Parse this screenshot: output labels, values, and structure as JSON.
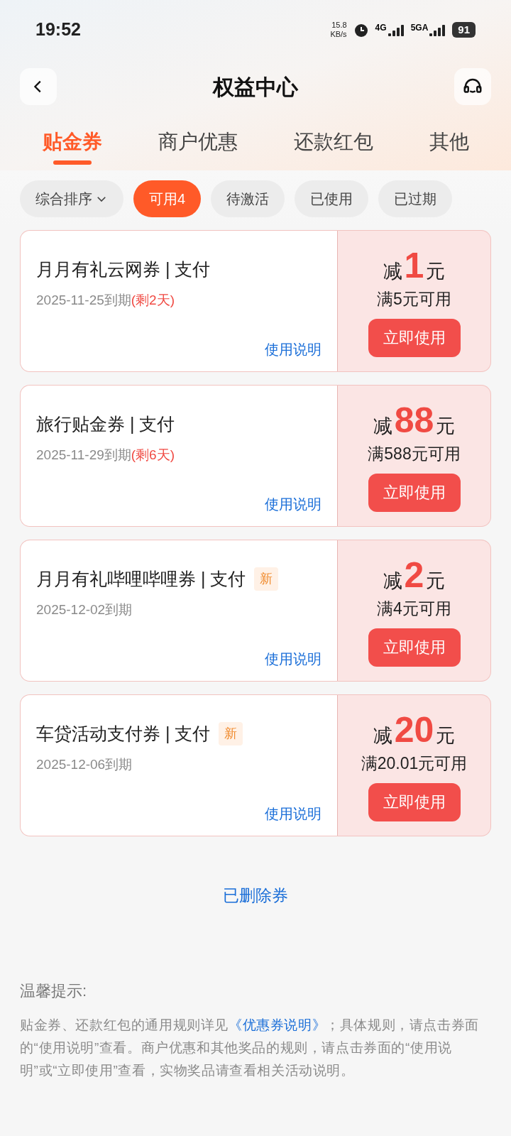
{
  "status_bar": {
    "time": "19:52",
    "speed_value": "15.8",
    "speed_unit": "KB/s",
    "network_1": "4G",
    "network_2": "5GA",
    "battery": "91"
  },
  "header": {
    "title": "权益中心"
  },
  "tabs": [
    {
      "label": "贴金券",
      "selected": true
    },
    {
      "label": "商户优惠",
      "selected": false
    },
    {
      "label": "还款红包",
      "selected": false
    },
    {
      "label": "其他",
      "selected": false
    }
  ],
  "filters": [
    {
      "label": "综合排序",
      "kind": "dropdown",
      "selected": false
    },
    {
      "label": "可用4",
      "kind": "chip",
      "selected": true
    },
    {
      "label": "待激活",
      "kind": "chip",
      "selected": false
    },
    {
      "label": "已使用",
      "kind": "chip",
      "selected": false
    },
    {
      "label": "已过期",
      "kind": "chip",
      "selected": false
    }
  ],
  "coupons": [
    {
      "title": "月月有礼云网券 | 支付",
      "new": false,
      "expiry": "2025-11-25到期",
      "remaining": "(剩2天)",
      "prefix": "减",
      "amount": "1",
      "unit": "元",
      "condition": "满5元可用",
      "button": "立即使用",
      "link": "使用说明"
    },
    {
      "title": "旅行贴金券 | 支付",
      "new": false,
      "expiry": "2025-11-29到期",
      "remaining": "(剩6天)",
      "prefix": "减",
      "amount": "88",
      "unit": "元",
      "condition": "满588元可用",
      "button": "立即使用",
      "link": "使用说明"
    },
    {
      "title": "月月有礼哔哩哔哩券 | 支付",
      "new": true,
      "new_label": "新",
      "expiry": "2025-12-02到期",
      "prefix": "减",
      "amount": "2",
      "unit": "元",
      "condition": "满4元可用",
      "button": "立即使用",
      "link": "使用说明"
    },
    {
      "title": "车贷活动支付券 | 支付",
      "new": true,
      "new_label": "新",
      "expiry": "2025-12-06到期",
      "prefix": "减",
      "amount": "20",
      "unit": "元",
      "condition": "满20.01元可用",
      "button": "立即使用",
      "link": "使用说明"
    }
  ],
  "deleted_link": "已删除券",
  "notice": {
    "title": "温馨提示:",
    "text_before": "贴金券、还款红包的通用规则详见",
    "link": "《优惠券说明》",
    "text_after": "；具体规则，请点击券面的“使用说明”查看。商户优惠和其他奖品的规则，请点击券面的“使用说明”或“立即使用”查看，实物奖品请查看相关活动说明。"
  }
}
